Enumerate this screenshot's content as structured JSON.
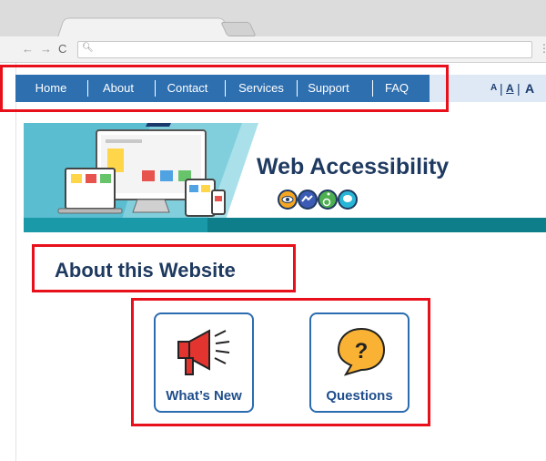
{
  "browser": {
    "back_icon": "back-arrow-icon",
    "forward_icon": "forward-arrow-icon",
    "reload_icon": "reload-icon",
    "search_icon": "magnifier-icon",
    "menu_icon": "more-vert-icon",
    "address": ""
  },
  "nav": {
    "items": [
      {
        "label": "Home"
      },
      {
        "label": "About"
      },
      {
        "label": "Contact"
      },
      {
        "label": "Services"
      },
      {
        "label": "Support"
      },
      {
        "label": "FAQ"
      }
    ],
    "color": "#2e6fb0"
  },
  "font_size_controls": {
    "small": "A",
    "sep1": "|",
    "medium": "A",
    "sep2": "|",
    "large": "A"
  },
  "banner": {
    "title": "Web Accessibility",
    "icons": [
      "eye-icon",
      "sign-language-icon",
      "wheelchair-icon",
      "brain-icon"
    ]
  },
  "main": {
    "heading": "About this Website",
    "cards": [
      {
        "label": "What’s New",
        "icon": "megaphone-icon"
      },
      {
        "label": "Questions",
        "icon": "question-bubble-icon"
      }
    ]
  },
  "highlight_color": "#e8101a"
}
